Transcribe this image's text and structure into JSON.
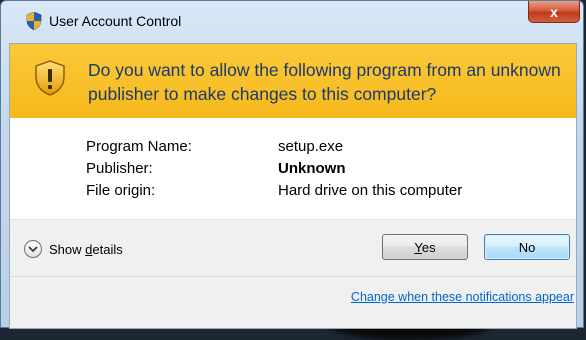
{
  "window": {
    "title": "User Account Control",
    "close_label": "x"
  },
  "banner": {
    "headline": "Do you want to allow the following program from an unknown publisher to make changes to this computer?"
  },
  "info": [
    {
      "label": "Program Name:",
      "value": "setup.exe"
    },
    {
      "label": "Publisher:",
      "value": "Unknown"
    },
    {
      "label": "File origin:",
      "value": "Hard drive on this computer"
    }
  ],
  "footer": {
    "details_prefix": "Show ",
    "details_accel": "d",
    "details_rest": "etails",
    "yes_accel": "Y",
    "yes_rest": "es",
    "no_label": "No",
    "link": "Change when these notifications appear"
  },
  "colors": {
    "banner": "#f6b91b",
    "headline": "#1b3a6b",
    "link": "#0066cc"
  },
  "icons": {
    "title": "uac-shield-icon",
    "banner": "warning-shield-icon",
    "details": "chevron-down-icon"
  }
}
